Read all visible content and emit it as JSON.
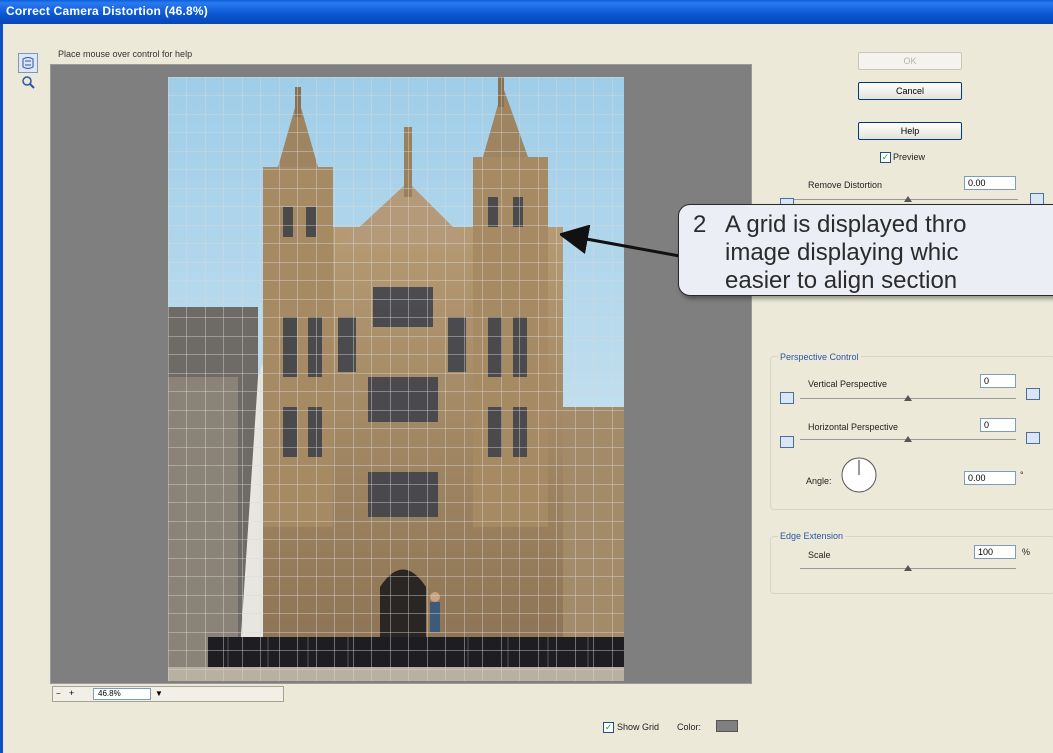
{
  "window": {
    "title": "Correct Camera Distortion (46.8%)",
    "help_text": "Place mouse over control for help"
  },
  "buttons": {
    "ok_label": "OK",
    "cancel_label": "Cancel",
    "help_label": "Help"
  },
  "preview_checkbox": {
    "label": "Preview",
    "checked": true
  },
  "remove_distortion": {
    "label": "Remove Distortion",
    "value": "0.00"
  },
  "perspective": {
    "title": "Perspective Control",
    "vertical_label": "Vertical Perspective",
    "vertical_value": "0",
    "horizontal_label": "Horizontal Perspective",
    "horizontal_value": "0",
    "angle_label": "Angle:",
    "angle_value": "0.00",
    "angle_unit": "°"
  },
  "edge": {
    "title": "Edge Extension",
    "scale_label": "Scale",
    "scale_value": "100",
    "scale_unit": "%"
  },
  "bottom": {
    "zoom_value": "46.8%",
    "show_grid_label": "Show Grid",
    "show_grid_checked": true,
    "color_label": "Color:",
    "grid_color": "#808080"
  },
  "callout": {
    "number": "2",
    "line1": "A grid is displayed thro",
    "line2": "image displaying whic",
    "line3": "easier to align section"
  },
  "colors": {
    "titlebar": "#0a56d0",
    "dialog_bg": "#ece9d8",
    "preview_bg": "#7f7f7f",
    "grid": "#d0d0d0"
  }
}
